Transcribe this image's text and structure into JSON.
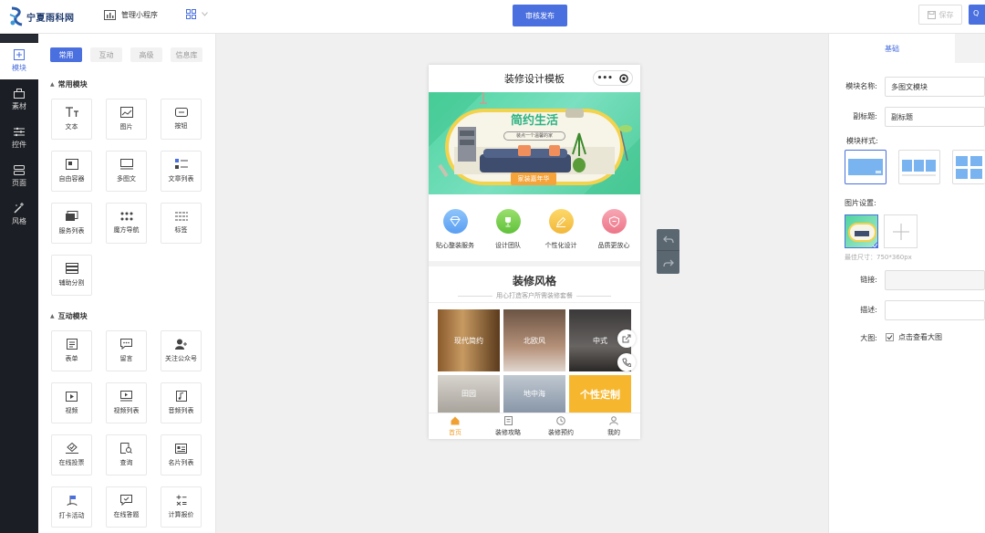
{
  "header": {
    "logo_text": "宁夏雨科网",
    "manage_label": "管理小程序",
    "publish_label": "审核发布",
    "save_label": "保存",
    "edge_label": "Q"
  },
  "sidebar": {
    "items": [
      {
        "label": "模块",
        "icon": "module-icon",
        "active": true
      },
      {
        "label": "素材",
        "icon": "material-icon"
      },
      {
        "label": "控件",
        "icon": "control-icon"
      },
      {
        "label": "页面",
        "icon": "page-icon"
      },
      {
        "label": "风格",
        "icon": "style-icon"
      }
    ]
  },
  "panel": {
    "tabs": [
      "常用",
      "互动",
      "高级",
      "信息库"
    ],
    "common_title": "常用模块",
    "common_items": [
      "文本",
      "图片",
      "按钮",
      "自由容器",
      "多图文",
      "文章列表",
      "服务列表",
      "魔方导航",
      "标签",
      "辅助分割"
    ],
    "interact_title": "互动模块",
    "interact_items": [
      "表单",
      "留言",
      "关注公众号",
      "视频",
      "视频列表",
      "音频列表",
      "在线投票",
      "查询",
      "名片列表",
      "打卡活动",
      "在线答题",
      "计算报价"
    ]
  },
  "phone": {
    "title": "装修设计模板",
    "capsule_dots": "•••",
    "banner": {
      "headline": "简约生活",
      "sub": "装点一个温馨的家",
      "button": "家装嘉年华"
    },
    "icons": [
      {
        "label": "贴心整装服务",
        "color": "#6aaef5"
      },
      {
        "label": "设计团队",
        "color": "#7bd354"
      },
      {
        "label": "个性化设计",
        "color": "#f5c542"
      },
      {
        "label": "品质更放心",
        "color": "#f08a9a"
      }
    ],
    "style_title": "装修风格",
    "style_sub": "用心打造客户所需装修套餐",
    "photos": [
      "现代简约",
      "北欧风",
      "中式",
      "田园",
      "地中海",
      "个性定制"
    ],
    "tabbar": [
      "首页",
      "装修攻略",
      "装修预约",
      "我的"
    ]
  },
  "props": {
    "tab_label": "基础",
    "name_label": "模块名称:",
    "name_value": "多图文模块",
    "subtitle_label": "副标题:",
    "subtitle_value": "副标题",
    "style_label": "模块样式:",
    "image_label": "图片设置:",
    "image_hint": "最佳尺寸：750*360px",
    "link_label": "链接:",
    "desc_label": "描述:",
    "bigimg_label": "大图:",
    "bigimg_option": "点击查看大图",
    "bigimg_checked": true
  },
  "colors": {
    "accent": "#4a6fde",
    "sidebar": "#1b1e24",
    "tab_active": "#f0a030"
  }
}
